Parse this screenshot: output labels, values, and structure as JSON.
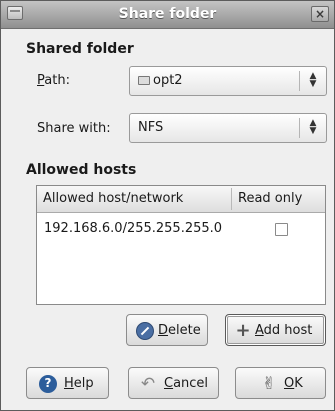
{
  "window": {
    "title": "Share folder",
    "close_icon": "close-icon"
  },
  "shared_folder": {
    "heading": "Shared folder",
    "path_label_mnemonic": "P",
    "path_label_rest": "ath:",
    "path_value": "opt2",
    "share_with_label": "Share with:",
    "share_with_value": "NFS"
  },
  "allowed_hosts": {
    "heading": "Allowed hosts",
    "columns": [
      "Allowed host/network",
      "Read only"
    ],
    "rows": [
      {
        "host": "192.168.6.0/255.255.255.0",
        "read_only": false
      }
    ]
  },
  "buttons": {
    "delete_mnemonic": "D",
    "delete_rest": "elete",
    "add_host_mnemonic": "A",
    "add_host_rest": "dd host",
    "help_mnemonic": "H",
    "help_rest": "elp",
    "cancel_mnemonic": "C",
    "cancel_rest": "ancel",
    "ok_mnemonic": "O",
    "ok_rest": "K"
  },
  "icons": {
    "delete": "no-entry-icon",
    "add_host": "plus-icon",
    "help": "help-icon",
    "cancel": "undo-icon",
    "ok": "ok-hand-icon"
  }
}
